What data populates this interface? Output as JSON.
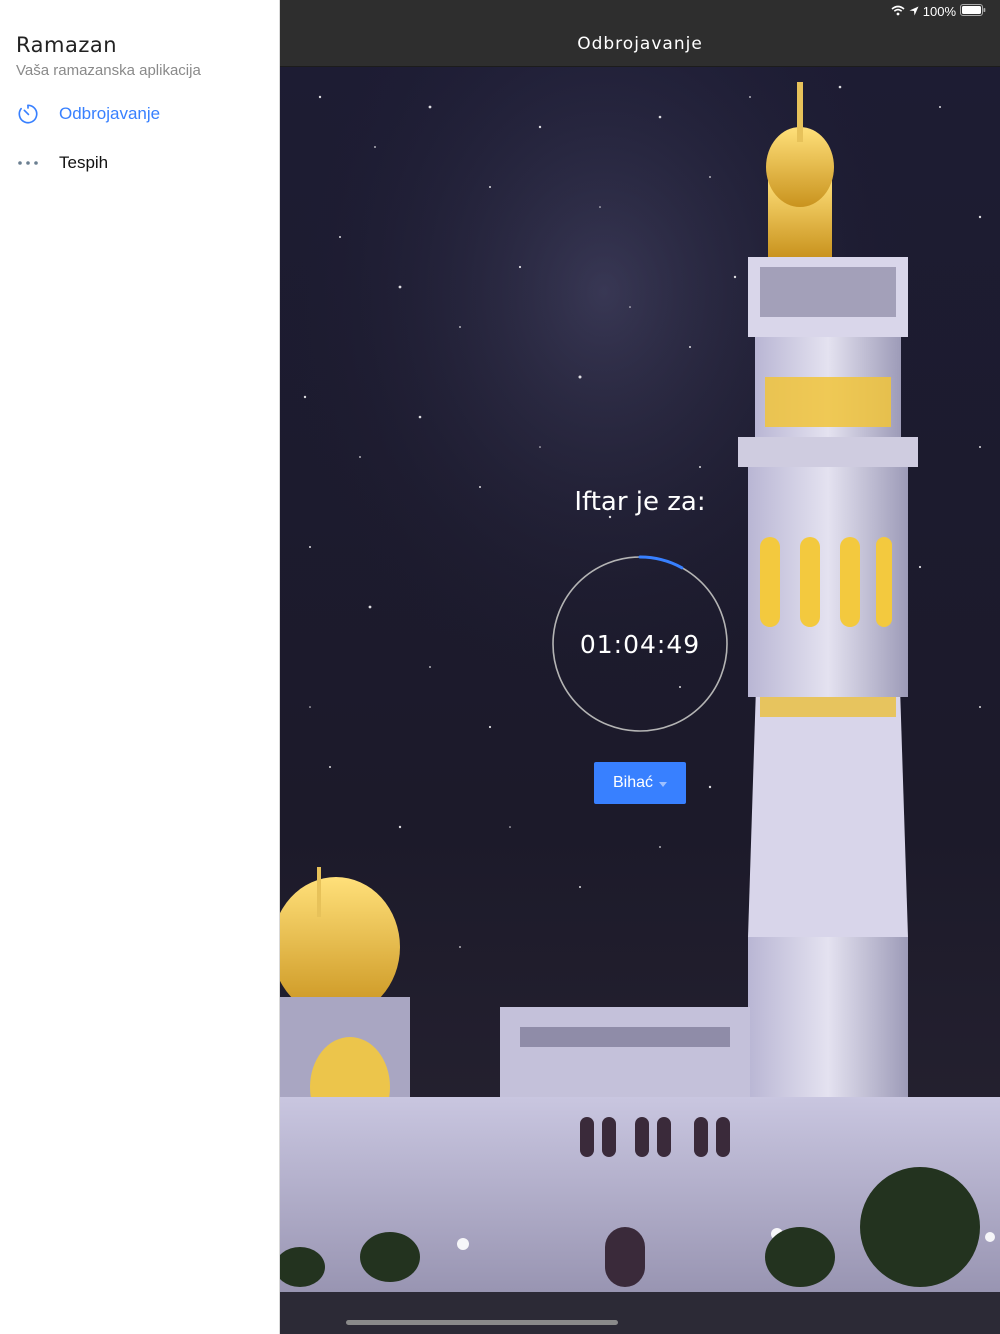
{
  "status": {
    "battery": "100%"
  },
  "sidebar": {
    "title": "Ramazan",
    "subtitle": "Vaša ramazanska aplikacija",
    "items": [
      {
        "label": "Odbrojavanje",
        "icon": "timer-icon",
        "active": true
      },
      {
        "label": "Tespih",
        "icon": "ellipsis-icon",
        "active": false
      }
    ]
  },
  "header": {
    "title": "Odbrojavanje"
  },
  "countdown": {
    "label": "Iftar je za:",
    "time": "01:04:49",
    "progress": 0.08
  },
  "city_select": {
    "value": "Bihać"
  },
  "colors": {
    "accent": "#3880ff",
    "toolbar": "#2e2e2e",
    "night_sky": "#1b1a2c"
  }
}
